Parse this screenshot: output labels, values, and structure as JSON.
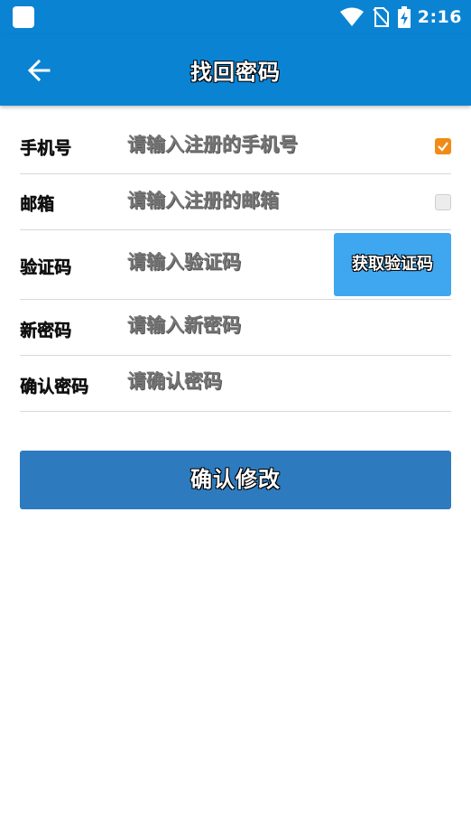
{
  "status_bar": {
    "time": "2:16",
    "icons": [
      "app-notification-icon",
      "wifi-icon",
      "no-sim-icon",
      "battery-charging-icon"
    ]
  },
  "app_bar": {
    "back_icon": "arrow-left-icon",
    "title": "找回密码"
  },
  "form": {
    "phone": {
      "label": "手机号",
      "placeholder": "请输入注册的手机号",
      "checked": true
    },
    "email": {
      "label": "邮箱",
      "placeholder": "请输入注册的邮箱",
      "checked": false
    },
    "code": {
      "label": "验证码",
      "placeholder": "请输入验证码",
      "button_label": "获取验证码"
    },
    "new_password": {
      "label": "新密码",
      "placeholder": "请输入新密码"
    },
    "confirm_password": {
      "label": "确认密码",
      "placeholder": "请确认密码"
    }
  },
  "submit_label": "确认修改",
  "colors": {
    "primary": "#0b83d3",
    "button": "#2d7bbe",
    "code_button": "#3ea7f0",
    "checkbox_checked": "#f08b16"
  }
}
